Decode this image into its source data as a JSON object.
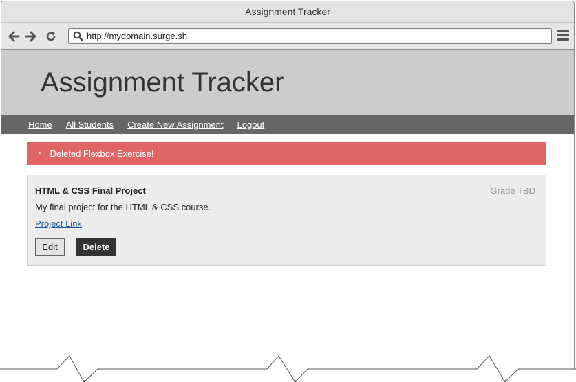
{
  "window": {
    "title": "Assignment Tracker"
  },
  "browser": {
    "url": "http://mydomain.surge.sh",
    "icons": [
      "back-arrow-icon",
      "forward-arrow-icon",
      "reload-icon",
      "search-icon",
      "hamburger-menu-icon"
    ]
  },
  "header": {
    "title": "Assignment Tracker"
  },
  "nav": {
    "items": [
      {
        "label": "Home"
      },
      {
        "label": "All Students"
      },
      {
        "label": "Create New Assignment"
      },
      {
        "label": "Logout"
      }
    ]
  },
  "flash": {
    "message": "Deleted Flexbox Exercise!",
    "color": "#e06666"
  },
  "assignment": {
    "title": "HTML & CSS Final Project",
    "grade": "Grade TBD",
    "description": "My final project for the HTML & CSS course.",
    "link_label": "Project Link",
    "edit_label": "Edit",
    "delete_label": "Delete"
  }
}
